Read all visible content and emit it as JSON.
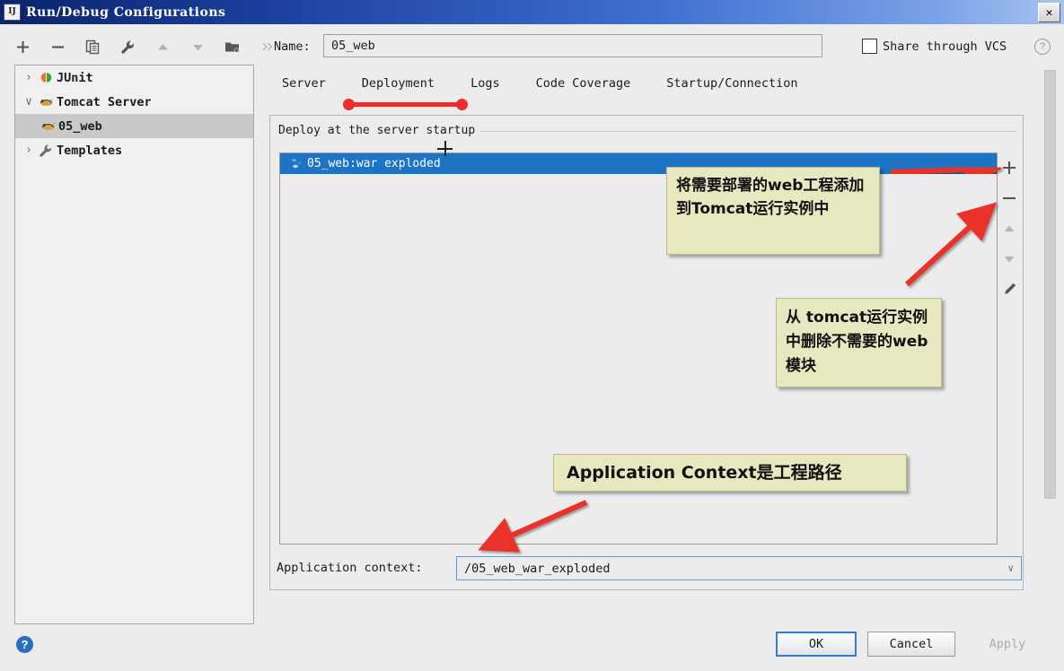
{
  "window": {
    "title": "Run/Debug Configurations",
    "icon": "intellij-idea-icon",
    "close_label": "✕"
  },
  "toolbar": {
    "buttons": [
      {
        "name": "add-configuration-button",
        "icon": "plus-icon",
        "enabled": true
      },
      {
        "name": "remove-configuration-button",
        "icon": "minus-icon",
        "enabled": true
      },
      {
        "name": "copy-configuration-button",
        "icon": "copy-icon",
        "enabled": true
      },
      {
        "name": "edit-templates-button",
        "icon": "wrench-icon",
        "enabled": true
      },
      {
        "name": "move-up-button",
        "icon": "arrow-up-icon",
        "enabled": false
      },
      {
        "name": "move-down-button",
        "icon": "arrow-down-icon",
        "enabled": false
      },
      {
        "name": "move-into-folder-button",
        "icon": "folder-add-icon",
        "enabled": true
      },
      {
        "name": "more-options-button",
        "icon": "chevron-double-right-icon",
        "label": "»",
        "enabled": true
      }
    ]
  },
  "tree": {
    "items": [
      {
        "label": "JUnit",
        "icon": "junit-icon",
        "twisty": "›",
        "expanded": false,
        "selected": false,
        "indent": false
      },
      {
        "label": "Tomcat Server",
        "icon": "tomcat-icon",
        "twisty": "∨",
        "expanded": true,
        "selected": false,
        "indent": false
      },
      {
        "label": "05_web",
        "icon": "tomcat-icon",
        "twisty": "",
        "expanded": false,
        "selected": true,
        "indent": true
      },
      {
        "label": "Templates",
        "icon": "wrench-icon",
        "twisty": "›",
        "expanded": false,
        "selected": false,
        "indent": false
      }
    ]
  },
  "header": {
    "name_label": "Name:",
    "name_value": "05_web",
    "share_label": "Share through VCS",
    "share_checked": false,
    "help_glyph": "?"
  },
  "tabs": [
    {
      "label": "Server",
      "active": false
    },
    {
      "label": "Deployment",
      "active": true
    },
    {
      "label": "Logs",
      "active": false
    },
    {
      "label": "Code Coverage",
      "active": false
    },
    {
      "label": "Startup/Connection",
      "active": false
    }
  ],
  "deployment": {
    "group_title": "Deploy at the server startup",
    "artifacts": [
      {
        "label": "05_web:war exploded",
        "icon": "artifact-icon",
        "selected": true
      }
    ],
    "side_buttons": [
      {
        "name": "add-artifact-button",
        "icon": "plus-icon",
        "glyph": "+",
        "enabled": true
      },
      {
        "name": "remove-artifact-button",
        "icon": "minus-icon",
        "glyph": "−",
        "enabled": true
      },
      {
        "name": "move-artifact-up-button",
        "icon": "triangle-up-icon",
        "glyph": "▲",
        "enabled": false
      },
      {
        "name": "move-artifact-down-button",
        "icon": "triangle-down-icon",
        "glyph": "▼",
        "enabled": false
      },
      {
        "name": "edit-artifact-button",
        "icon": "pencil-icon",
        "glyph": "✎",
        "enabled": true
      }
    ],
    "context_label": "Application context:",
    "context_value": "/05_web_war_exploded",
    "context_arrow": "∨"
  },
  "footer": {
    "help_glyph": "?",
    "ok_label": "OK",
    "cancel_label": "Cancel",
    "apply_label": "Apply",
    "apply_enabled": false
  },
  "annotations": [
    {
      "id": "anno1",
      "text": "将需要部署的web工程添加到Tomcat运行实例中"
    },
    {
      "id": "anno2",
      "text": "从 tomcat运行实例中删除不需要的web模块"
    },
    {
      "id": "anno3",
      "text": "Application Context是工程路径"
    }
  ],
  "colors": {
    "titlebar_blue": "#1c3f9e",
    "selection_blue": "#1d74c4",
    "annotation_red": "#ef2b2b",
    "annotation_bg": "#e8e8c0",
    "panel_bg": "#ececec",
    "focus_border": "#5a9fd4"
  }
}
